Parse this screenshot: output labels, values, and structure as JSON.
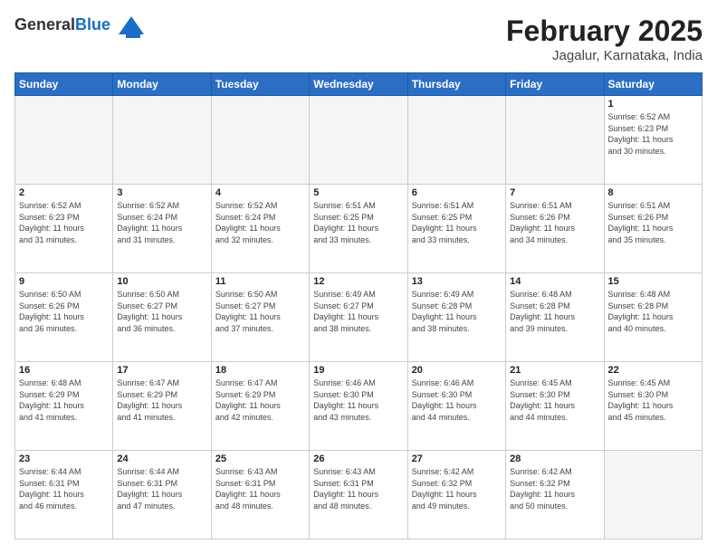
{
  "header": {
    "logo_general": "General",
    "logo_blue": "Blue",
    "title": "February 2025",
    "subtitle": "Jagalur, Karnataka, India"
  },
  "weekdays": [
    "Sunday",
    "Monday",
    "Tuesday",
    "Wednesday",
    "Thursday",
    "Friday",
    "Saturday"
  ],
  "weeks": [
    [
      {
        "day": "",
        "info": ""
      },
      {
        "day": "",
        "info": ""
      },
      {
        "day": "",
        "info": ""
      },
      {
        "day": "",
        "info": ""
      },
      {
        "day": "",
        "info": ""
      },
      {
        "day": "",
        "info": ""
      },
      {
        "day": "1",
        "info": "Sunrise: 6:52 AM\nSunset: 6:23 PM\nDaylight: 11 hours\nand 30 minutes."
      }
    ],
    [
      {
        "day": "2",
        "info": "Sunrise: 6:52 AM\nSunset: 6:23 PM\nDaylight: 11 hours\nand 31 minutes."
      },
      {
        "day": "3",
        "info": "Sunrise: 6:52 AM\nSunset: 6:24 PM\nDaylight: 11 hours\nand 31 minutes."
      },
      {
        "day": "4",
        "info": "Sunrise: 6:52 AM\nSunset: 6:24 PM\nDaylight: 11 hours\nand 32 minutes."
      },
      {
        "day": "5",
        "info": "Sunrise: 6:51 AM\nSunset: 6:25 PM\nDaylight: 11 hours\nand 33 minutes."
      },
      {
        "day": "6",
        "info": "Sunrise: 6:51 AM\nSunset: 6:25 PM\nDaylight: 11 hours\nand 33 minutes."
      },
      {
        "day": "7",
        "info": "Sunrise: 6:51 AM\nSunset: 6:26 PM\nDaylight: 11 hours\nand 34 minutes."
      },
      {
        "day": "8",
        "info": "Sunrise: 6:51 AM\nSunset: 6:26 PM\nDaylight: 11 hours\nand 35 minutes."
      }
    ],
    [
      {
        "day": "9",
        "info": "Sunrise: 6:50 AM\nSunset: 6:26 PM\nDaylight: 11 hours\nand 36 minutes."
      },
      {
        "day": "10",
        "info": "Sunrise: 6:50 AM\nSunset: 6:27 PM\nDaylight: 11 hours\nand 36 minutes."
      },
      {
        "day": "11",
        "info": "Sunrise: 6:50 AM\nSunset: 6:27 PM\nDaylight: 11 hours\nand 37 minutes."
      },
      {
        "day": "12",
        "info": "Sunrise: 6:49 AM\nSunset: 6:27 PM\nDaylight: 11 hours\nand 38 minutes."
      },
      {
        "day": "13",
        "info": "Sunrise: 6:49 AM\nSunset: 6:28 PM\nDaylight: 11 hours\nand 38 minutes."
      },
      {
        "day": "14",
        "info": "Sunrise: 6:48 AM\nSunset: 6:28 PM\nDaylight: 11 hours\nand 39 minutes."
      },
      {
        "day": "15",
        "info": "Sunrise: 6:48 AM\nSunset: 6:28 PM\nDaylight: 11 hours\nand 40 minutes."
      }
    ],
    [
      {
        "day": "16",
        "info": "Sunrise: 6:48 AM\nSunset: 6:29 PM\nDaylight: 11 hours\nand 41 minutes."
      },
      {
        "day": "17",
        "info": "Sunrise: 6:47 AM\nSunset: 6:29 PM\nDaylight: 11 hours\nand 41 minutes."
      },
      {
        "day": "18",
        "info": "Sunrise: 6:47 AM\nSunset: 6:29 PM\nDaylight: 11 hours\nand 42 minutes."
      },
      {
        "day": "19",
        "info": "Sunrise: 6:46 AM\nSunset: 6:30 PM\nDaylight: 11 hours\nand 43 minutes."
      },
      {
        "day": "20",
        "info": "Sunrise: 6:46 AM\nSunset: 6:30 PM\nDaylight: 11 hours\nand 44 minutes."
      },
      {
        "day": "21",
        "info": "Sunrise: 6:45 AM\nSunset: 6:30 PM\nDaylight: 11 hours\nand 44 minutes."
      },
      {
        "day": "22",
        "info": "Sunrise: 6:45 AM\nSunset: 6:30 PM\nDaylight: 11 hours\nand 45 minutes."
      }
    ],
    [
      {
        "day": "23",
        "info": "Sunrise: 6:44 AM\nSunset: 6:31 PM\nDaylight: 11 hours\nand 46 minutes."
      },
      {
        "day": "24",
        "info": "Sunrise: 6:44 AM\nSunset: 6:31 PM\nDaylight: 11 hours\nand 47 minutes."
      },
      {
        "day": "25",
        "info": "Sunrise: 6:43 AM\nSunset: 6:31 PM\nDaylight: 11 hours\nand 48 minutes."
      },
      {
        "day": "26",
        "info": "Sunrise: 6:43 AM\nSunset: 6:31 PM\nDaylight: 11 hours\nand 48 minutes."
      },
      {
        "day": "27",
        "info": "Sunrise: 6:42 AM\nSunset: 6:32 PM\nDaylight: 11 hours\nand 49 minutes."
      },
      {
        "day": "28",
        "info": "Sunrise: 6:42 AM\nSunset: 6:32 PM\nDaylight: 11 hours\nand 50 minutes."
      },
      {
        "day": "",
        "info": ""
      }
    ]
  ]
}
